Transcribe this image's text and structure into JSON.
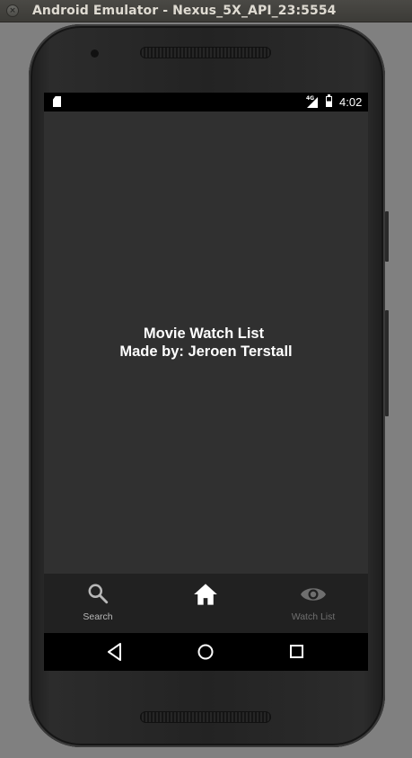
{
  "window": {
    "title": "Android Emulator - Nexus_5X_API_23:5554",
    "close_icon": "close-icon"
  },
  "statusbar": {
    "network": "4G",
    "time": "4:02"
  },
  "main": {
    "line1": "Movie Watch List",
    "line2": "Made by: Jeroen Terstall"
  },
  "bottom_nav": {
    "items": [
      {
        "label": "Search",
        "icon": "search-icon",
        "color": "#b8b8b8"
      },
      {
        "label": "",
        "icon": "home-icon",
        "color": "#ffffff",
        "active": true
      },
      {
        "label": "Watch List",
        "icon": "eye-icon",
        "color": "#6f6f6f"
      }
    ]
  },
  "system_nav": {
    "back": "back-icon",
    "home": "home-circle-icon",
    "recents": "recents-icon"
  },
  "colors": {
    "screen_bg": "#303030",
    "nav_bg": "#212121",
    "text": "#ffffff"
  }
}
